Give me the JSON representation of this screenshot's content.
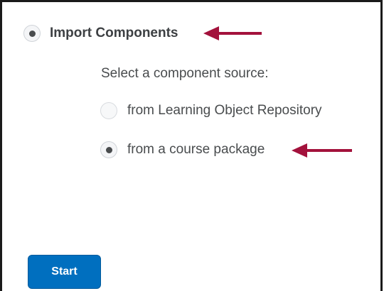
{
  "import_option": {
    "label": "Import Components",
    "checked": true
  },
  "source_prompt": "Select a component source:",
  "sources": [
    {
      "label": "from Learning Object Repository",
      "checked": false
    },
    {
      "label": "from a course package",
      "checked": true
    }
  ],
  "start_button": {
    "label": "Start"
  },
  "colors": {
    "annotation_arrow": "#a3123c",
    "button_blue": "#006fbf",
    "text": "#494c4e"
  }
}
